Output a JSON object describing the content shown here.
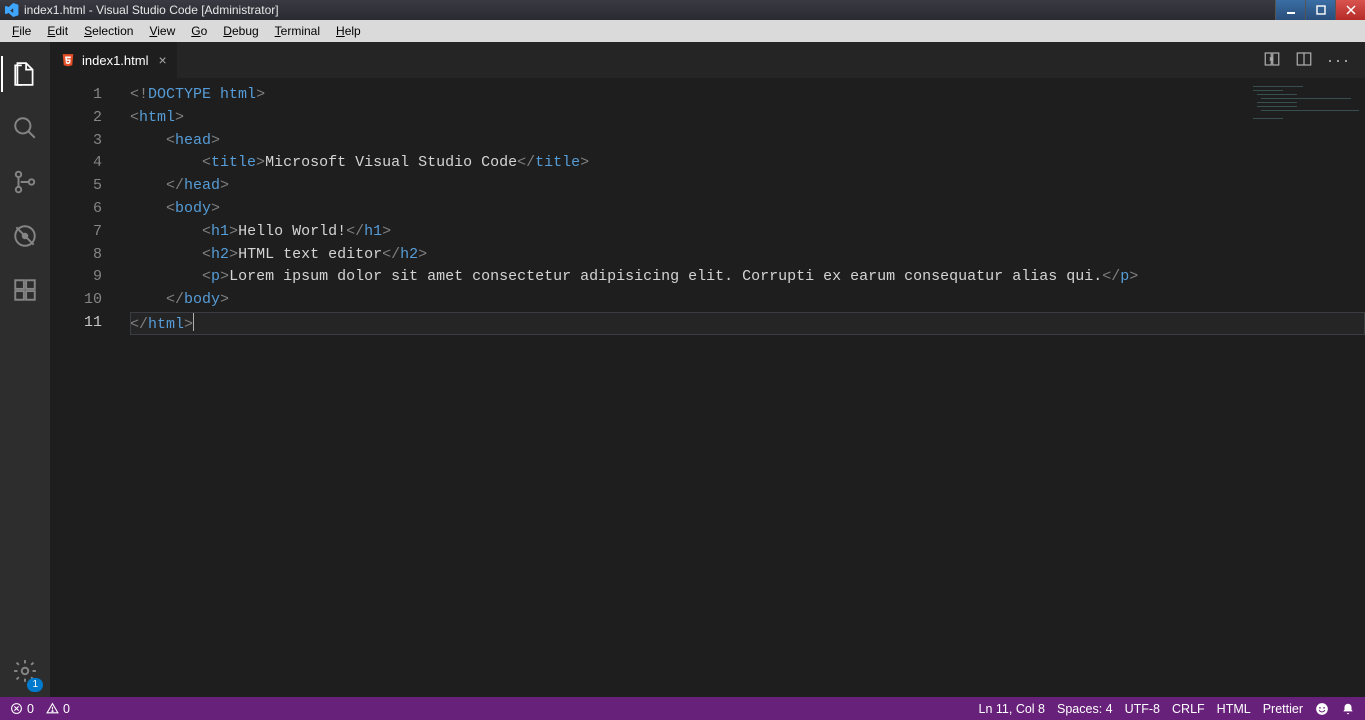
{
  "window": {
    "title": "index1.html - Visual Studio Code [Administrator]"
  },
  "menubar": {
    "items": [
      {
        "label": "File",
        "hotkey_index": 0
      },
      {
        "label": "Edit",
        "hotkey_index": 0
      },
      {
        "label": "Selection",
        "hotkey_index": 0
      },
      {
        "label": "View",
        "hotkey_index": 0
      },
      {
        "label": "Go",
        "hotkey_index": 0
      },
      {
        "label": "Debug",
        "hotkey_index": 0
      },
      {
        "label": "Terminal",
        "hotkey_index": 0
      },
      {
        "label": "Help",
        "hotkey_index": 0
      }
    ]
  },
  "activitybar": {
    "items": [
      {
        "name": "explorer-icon",
        "active": true
      },
      {
        "name": "search-icon",
        "active": false
      },
      {
        "name": "source-control-icon",
        "active": false
      },
      {
        "name": "debug-icon",
        "active": false
      },
      {
        "name": "extensions-icon",
        "active": false
      }
    ],
    "settings_badge": "1"
  },
  "tabs": [
    {
      "filename": "index1.html",
      "dirty": false,
      "active": true
    }
  ],
  "editor": {
    "line_numbers": [
      1,
      2,
      3,
      4,
      5,
      6,
      7,
      8,
      9,
      10,
      11
    ],
    "current_line": 11,
    "code_lines": [
      {
        "tokens": [
          [
            "br",
            "<"
          ],
          [
            "excl",
            "!"
          ],
          [
            "doct",
            "DOCTYPE "
          ],
          [
            "html",
            "html"
          ],
          [
            "br",
            ">"
          ]
        ]
      },
      {
        "tokens": [
          [
            "br",
            "<"
          ],
          [
            "tag",
            "html"
          ],
          [
            "br",
            ">"
          ]
        ]
      },
      {
        "tokens": [
          [
            "text",
            "    "
          ],
          [
            "br",
            "<"
          ],
          [
            "tag",
            "head"
          ],
          [
            "br",
            ">"
          ]
        ]
      },
      {
        "tokens": [
          [
            "text",
            "        "
          ],
          [
            "br",
            "<"
          ],
          [
            "tag",
            "title"
          ],
          [
            "br",
            ">"
          ],
          [
            "text",
            "Microsoft Visual Studio Code"
          ],
          [
            "br",
            "</"
          ],
          [
            "tag",
            "title"
          ],
          [
            "br",
            ">"
          ]
        ]
      },
      {
        "tokens": [
          [
            "text",
            "    "
          ],
          [
            "br",
            "</"
          ],
          [
            "tag",
            "head"
          ],
          [
            "br",
            ">"
          ]
        ]
      },
      {
        "tokens": [
          [
            "text",
            "    "
          ],
          [
            "br",
            "<"
          ],
          [
            "tag",
            "body"
          ],
          [
            "br",
            ">"
          ]
        ]
      },
      {
        "tokens": [
          [
            "text",
            "        "
          ],
          [
            "br",
            "<"
          ],
          [
            "tag",
            "h1"
          ],
          [
            "br",
            ">"
          ],
          [
            "text",
            "Hello World!"
          ],
          [
            "br",
            "</"
          ],
          [
            "tag",
            "h1"
          ],
          [
            "br",
            ">"
          ]
        ]
      },
      {
        "tokens": [
          [
            "text",
            "        "
          ],
          [
            "br",
            "<"
          ],
          [
            "tag",
            "h2"
          ],
          [
            "br",
            ">"
          ],
          [
            "text",
            "HTML text editor"
          ],
          [
            "br",
            "</"
          ],
          [
            "tag",
            "h2"
          ],
          [
            "br",
            ">"
          ]
        ]
      },
      {
        "tokens": [
          [
            "text",
            "        "
          ],
          [
            "br",
            "<"
          ],
          [
            "tag",
            "p"
          ],
          [
            "br",
            ">"
          ],
          [
            "text",
            "Lorem ipsum dolor sit amet consectetur adipisicing elit. Corrupti ex earum consequatur alias qui."
          ],
          [
            "br",
            "</"
          ],
          [
            "tag",
            "p"
          ],
          [
            "br",
            ">"
          ]
        ]
      },
      {
        "tokens": [
          [
            "text",
            "    "
          ],
          [
            "br",
            "</"
          ],
          [
            "tag",
            "body"
          ],
          [
            "br",
            ">"
          ]
        ]
      },
      {
        "tokens": [
          [
            "br",
            "</"
          ],
          [
            "tag",
            "html"
          ],
          [
            "br",
            ">"
          ]
        ],
        "current": true
      }
    ]
  },
  "statusbar": {
    "errors": "0",
    "warnings": "0",
    "cursor": "Ln 11, Col 8",
    "spaces": "Spaces: 4",
    "encoding": "UTF-8",
    "eol": "CRLF",
    "language": "HTML",
    "formatter": "Prettier"
  }
}
